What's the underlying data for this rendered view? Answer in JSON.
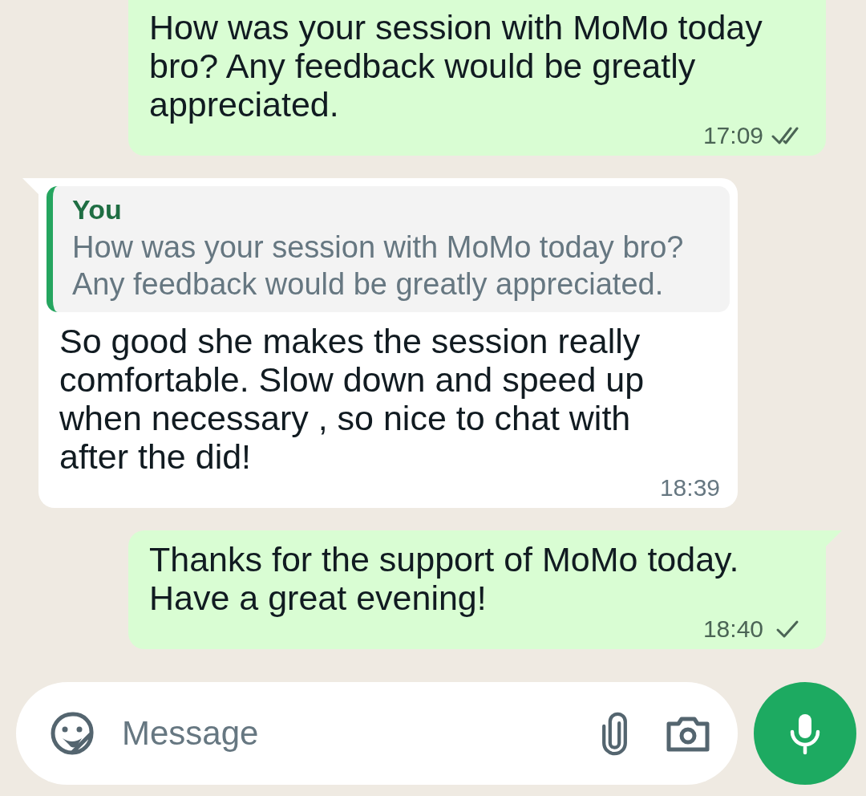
{
  "messages": [
    {
      "kind": "outgoing",
      "text": "How was your session with MoMo today bro? Any feedback would be greatly appreciated.",
      "time": "17:09",
      "delivered": true
    },
    {
      "kind": "incoming",
      "quote": {
        "author": "You",
        "text": "How was your session with MoMo today bro? Any feedback would be greatly appreciated."
      },
      "text": "So good she makes the session really comfortable. Slow down and speed up when necessary , so nice to chat with after the did!",
      "time": "18:39"
    },
    {
      "kind": "outgoing",
      "text": "Thanks for the support of MoMo today. Have a great evening!",
      "time": "18:40",
      "delivered": false
    }
  ],
  "composer": {
    "placeholder": "Message"
  }
}
